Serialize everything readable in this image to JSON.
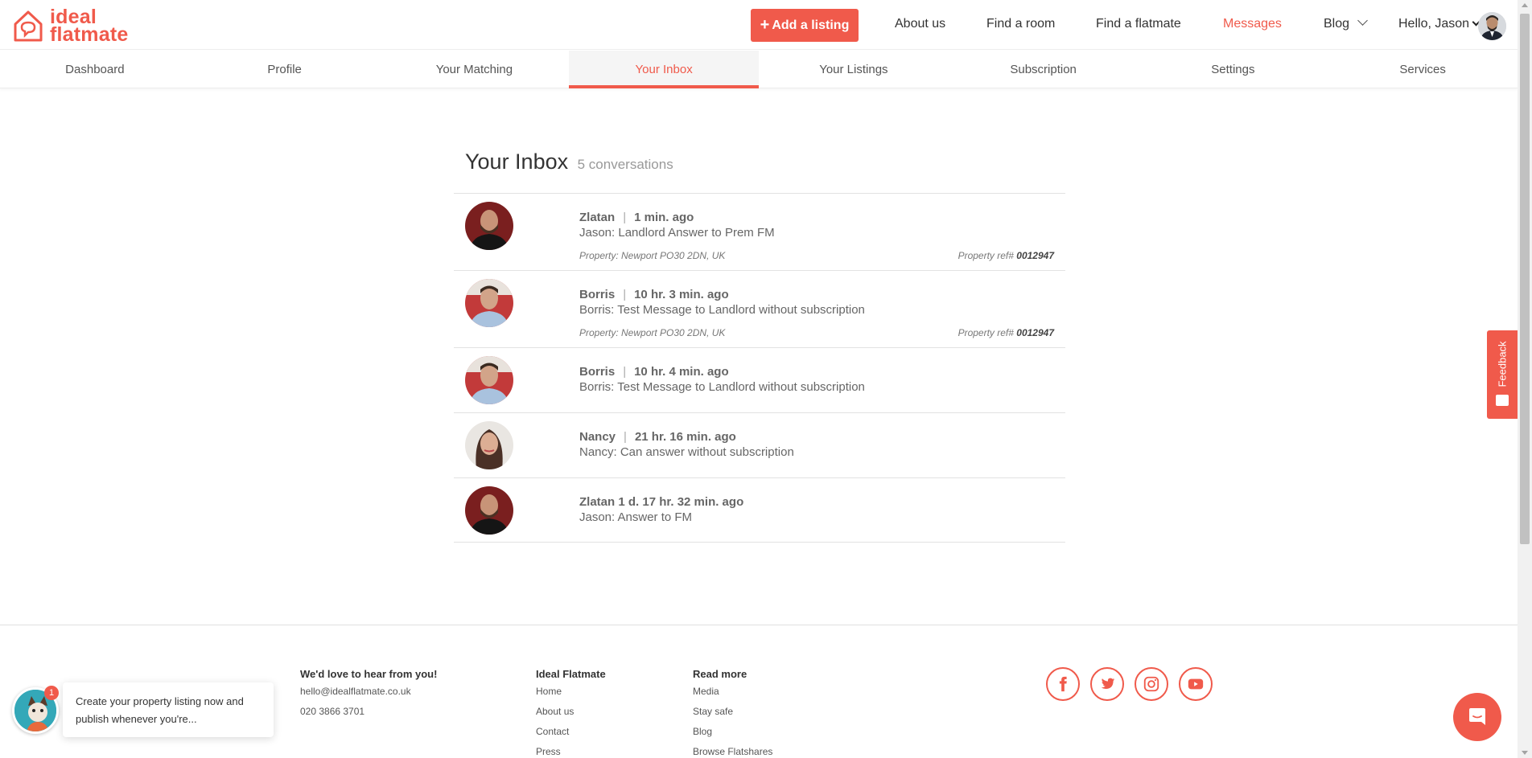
{
  "brand": {
    "line1": "ideal",
    "line2": "flatmate",
    "accent": "#f05a4b"
  },
  "header": {
    "add_listing": "Add a listing",
    "nav": [
      "About us",
      "Find a room",
      "Find a flatmate",
      "Messages",
      "Blog"
    ],
    "greeting": "Hello, Jason"
  },
  "tabs": [
    "Dashboard",
    "Profile",
    "Your Matching",
    "Your Inbox",
    "Your Listings",
    "Subscription",
    "Settings",
    "Services"
  ],
  "inbox": {
    "title": "Your Inbox",
    "count": "5 conversations",
    "conversations": [
      {
        "name": "Zlatan",
        "sep": "|",
        "time": "1 min. ago",
        "message": "Jason: Landlord Answer to Prem FM",
        "property": "Property: Newport PO30 2DN, UK",
        "ref_label": "Property ref#",
        "ref": "0012947"
      },
      {
        "name": "Borris",
        "sep": "|",
        "time": "10 hr. 3 min. ago",
        "message": "Borris: Test Message to Landlord without subscription",
        "property": "Property: Newport PO30 2DN, UK",
        "ref_label": "Property ref#",
        "ref": "0012947"
      },
      {
        "name": "Borris",
        "sep": "|",
        "time": "10 hr. 4 min. ago",
        "message": "Borris: Test Message to Landlord without subscription"
      },
      {
        "name": "Nancy",
        "sep": "|",
        "time": "21 hr. 16 min. ago",
        "message": "Nancy: Can answer without subscription"
      },
      {
        "name": "Zlatan 1 d. 17 hr. 32 min. ago",
        "message": "Jason: Answer to FM"
      }
    ]
  },
  "feedback": "Feedback",
  "footer": {
    "contact": {
      "heading": "We'd love to hear from you!",
      "email": "hello@idealflatmate.co.uk",
      "phone": "020 3866 3701"
    },
    "company": {
      "heading": "Ideal Flatmate",
      "links": [
        "Home",
        "About us",
        "Contact",
        "Press"
      ]
    },
    "read_more": {
      "heading": "Read more",
      "links": [
        "Media",
        "Stay safe",
        "Blog",
        "Browse Flatshares"
      ]
    },
    "socials": [
      "facebook-icon",
      "twitter-icon",
      "instagram-icon",
      "youtube-icon"
    ]
  },
  "chat": {
    "popup": "Create your property listing now and publish whenever you're...",
    "badge": "1"
  }
}
